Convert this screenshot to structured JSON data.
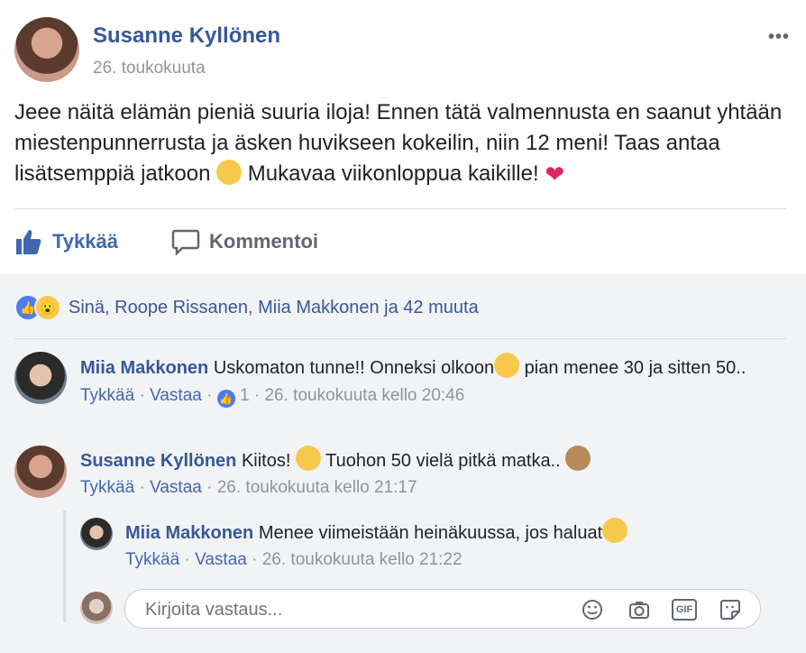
{
  "post": {
    "author": "Susanne Kyllönen",
    "date": "26. toukokuuta",
    "more_label": "•••",
    "text_part1": "Jeee näitä elämän pieniä suuria iloja! Ennen tätä valmennusta en saanut yhtään miestenpunnerrusta ja äsken huvikseen kokeilin, niin 12 meni! Taas antaa lisätsemppiä jatkoon ",
    "text_part2": " Mukavaa viikonloppua kaikille! ",
    "heart": "❤"
  },
  "actions": {
    "like_label": "Tykkää",
    "comment_label": "Kommentoi"
  },
  "reactions": {
    "summary": "Sinä, Roope Rissanen, Miia Makkonen ja 42 muuta"
  },
  "comments": [
    {
      "author": "Miia Makkonen",
      "text_a": "Uskomaton tunne!! Onneksi olkoon",
      "text_b": " pian menee 30 ja sitten 50..",
      "like": "Tykkää",
      "reply": "Vastaa",
      "like_count": "1",
      "time": "26. toukokuuta kello 20:46"
    },
    {
      "author": "Susanne Kyllönen",
      "text_a": "Kiitos! ",
      "text_b": " Tuohon 50 vielä pitkä matka.. ",
      "like": "Tykkää",
      "reply": "Vastaa",
      "time": "26. toukokuuta kello 21:17"
    },
    {
      "author": "Miia Makkonen",
      "text_a": "Menee viimeistään heinäkuussa, jos haluat",
      "like": "Tykkää",
      "reply": "Vastaa",
      "time": "26. toukokuuta kello 21:22"
    }
  ],
  "reply_box": {
    "placeholder": "Kirjoita vastaus...",
    "gif_label": "GIF"
  },
  "colors": {
    "link_blue": "#365899",
    "accent_blue": "#4267b2",
    "meta_gray": "#90949c",
    "comments_bg": "#f2f3f5"
  }
}
